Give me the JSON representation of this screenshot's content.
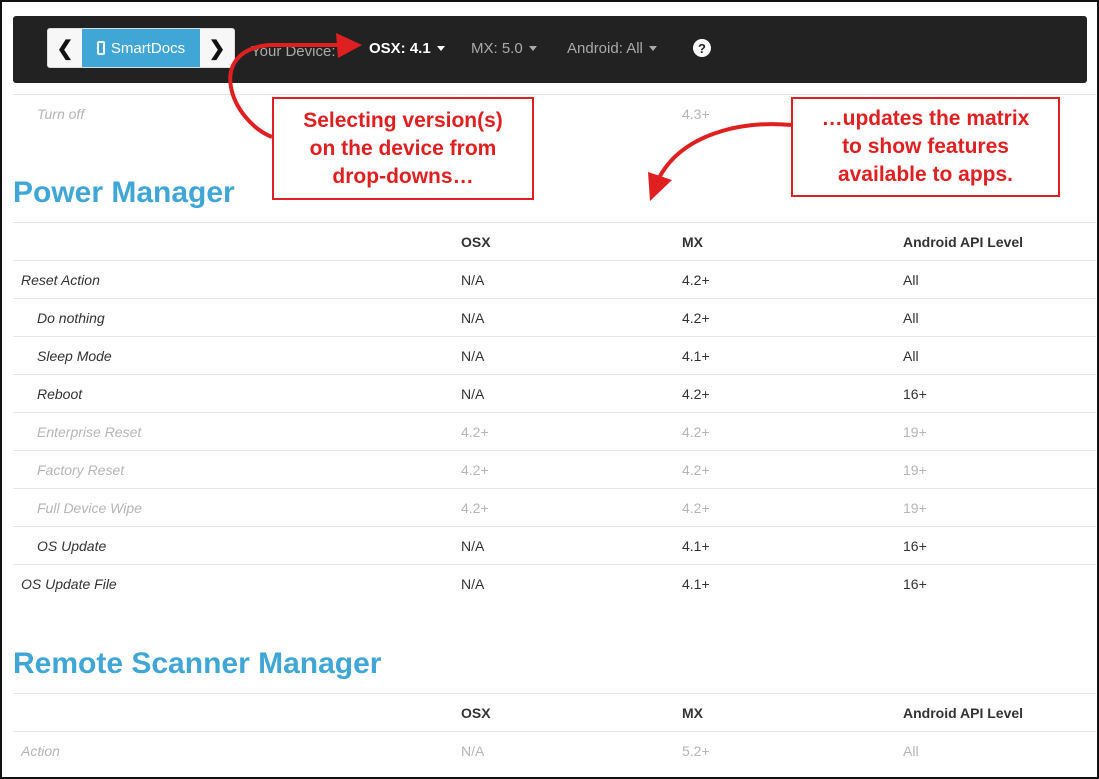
{
  "nav": {
    "brand": "SmartDocs",
    "prev_label": "❮",
    "next_label": "❯",
    "device_label": "Your Device:",
    "osx_label": "OSX: 4.1",
    "mx_label": "MX: 5.0",
    "android_label": "Android: All",
    "help_label": "?"
  },
  "top_row": {
    "feature": "Turn off",
    "mx": "4.3+"
  },
  "sections": [
    {
      "title": "Power Manager",
      "columns": [
        "",
        "OSX",
        "MX",
        "Android API Level"
      ],
      "rows": [
        {
          "feature": "Reset Action",
          "osx": "N/A",
          "mx": "4.2+",
          "android": "All"
        },
        {
          "feature": "Do nothing",
          "osx": "N/A",
          "mx": "4.2+",
          "android": "All"
        },
        {
          "feature": "Sleep Mode",
          "osx": "N/A",
          "mx": "4.1+",
          "android": "All"
        },
        {
          "feature": "Reboot",
          "osx": "N/A",
          "mx": "4.2+",
          "android": "16+"
        },
        {
          "feature": "Enterprise Reset",
          "osx": "4.2+",
          "mx": "4.2+",
          "android": "19+"
        },
        {
          "feature": "Factory Reset",
          "osx": "4.2+",
          "mx": "4.2+",
          "android": "19+"
        },
        {
          "feature": "Full Device Wipe",
          "osx": "4.2+",
          "mx": "4.2+",
          "android": "19+"
        },
        {
          "feature": "OS Update",
          "osx": "N/A",
          "mx": "4.1+",
          "android": "16+"
        },
        {
          "feature": "OS Update File",
          "osx": "N/A",
          "mx": "4.1+",
          "android": "16+"
        }
      ]
    },
    {
      "title": "Remote Scanner Manager",
      "columns": [
        "",
        "OSX",
        "MX",
        "Android API Level"
      ],
      "rows": [
        {
          "feature": "Action",
          "osx": "N/A",
          "mx": "5.2+",
          "android": "All"
        }
      ]
    }
  ],
  "callouts": {
    "left": [
      "Selecting version(s)",
      "on the device from",
      "drop-downs…"
    ],
    "right": [
      "…updates the matrix",
      "to show features",
      "available to apps."
    ]
  },
  "colors": {
    "accent": "#3fa6d6",
    "navbar": "#222222",
    "annotation": "#e02020",
    "muted": "#b5b5b5"
  }
}
